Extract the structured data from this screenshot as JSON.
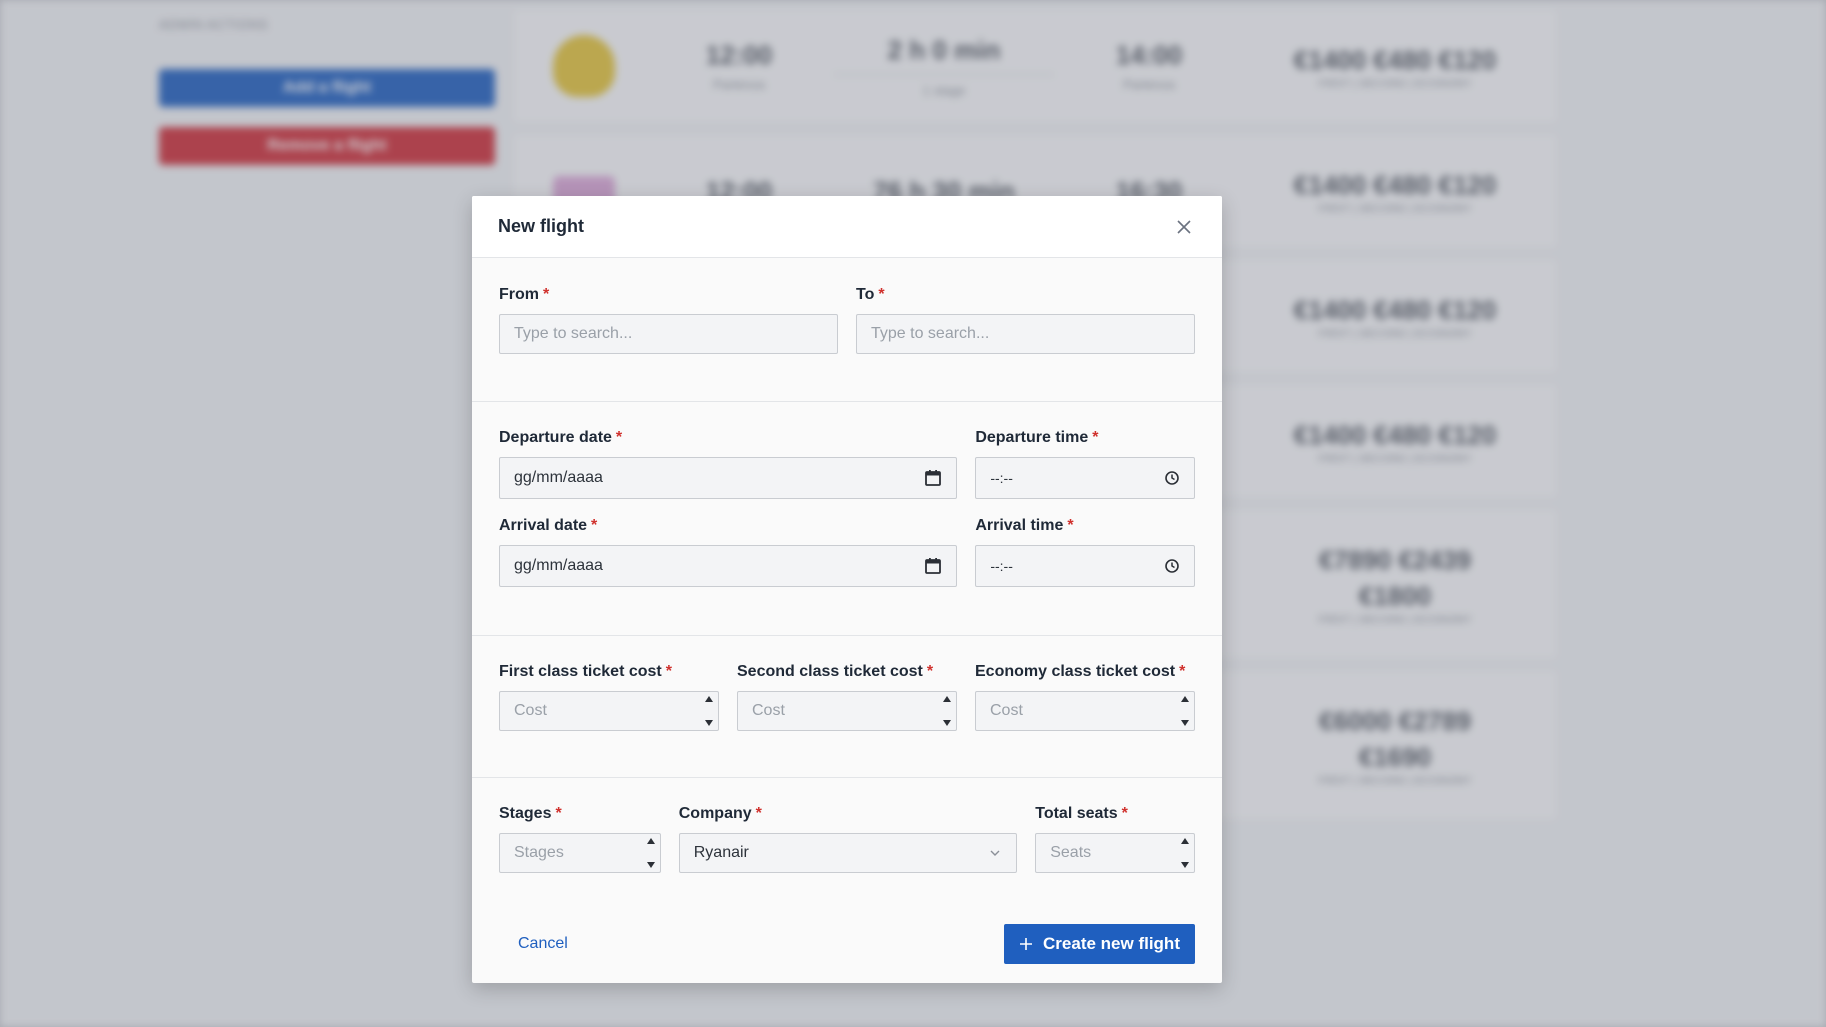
{
  "background": {
    "sidebar_title": "ADMIN ACTIONS",
    "add_button": "Add a flight",
    "remove_button": "Remove a flight",
    "flights": [
      {
        "depart": "12:00",
        "depart_sub": "Partenza",
        "duration": "2 h 0 min",
        "stages": "1 stage",
        "arrive": "14:00",
        "arrive_sub": "Partenza",
        "prices": "€1400 €480 €120",
        "prices_sub": "FIRST | SECOND | ECONOMY"
      },
      {
        "depart": "12:00",
        "depart_sub": "",
        "duration": "76 h 30 min",
        "stages": "",
        "arrive": "16:30",
        "arrive_sub": "",
        "prices": "€1400 €480 €120",
        "prices_sub": "FIRST | SECOND | ECONOMY"
      },
      {
        "prices": "€1400 €480 €120",
        "prices_sub": "FIRST | SECOND | ECONOMY"
      },
      {
        "prices": "€1400 €480 €120",
        "prices_sub": "FIRST | SECOND | ECONOMY"
      },
      {
        "prices": "€7890 €2439 €1800",
        "prices_sub": "FIRST | SECOND | ECONOMY"
      },
      {
        "prices": "€6000 €2789 €1690",
        "prices_sub": "FIRST | SECOND | ECONOMY"
      }
    ]
  },
  "modal": {
    "title": "New flight",
    "required_mark": "*",
    "from": {
      "label": "From",
      "placeholder": "Type to search..."
    },
    "to": {
      "label": "To",
      "placeholder": "Type to search..."
    },
    "departure_date": {
      "label": "Departure date",
      "value": "gg/mm/aaaa"
    },
    "departure_time": {
      "label": "Departure time",
      "value": "--:--"
    },
    "arrival_date": {
      "label": "Arrival date",
      "value": "gg/mm/aaaa"
    },
    "arrival_time": {
      "label": "Arrival time",
      "value": "--:--"
    },
    "first_cost": {
      "label": "First class ticket cost",
      "placeholder": "Cost"
    },
    "second_cost": {
      "label": "Second class ticket cost",
      "placeholder": "Cost"
    },
    "economy_cost": {
      "label": "Economy class ticket cost",
      "placeholder": "Cost"
    },
    "stages": {
      "label": "Stages",
      "placeholder": "Stages"
    },
    "company": {
      "label": "Company",
      "value": "Ryanair"
    },
    "total_seats": {
      "label": "Total seats",
      "placeholder": "Seats"
    },
    "cancel_label": "Cancel",
    "create_label": "Create new flight"
  }
}
